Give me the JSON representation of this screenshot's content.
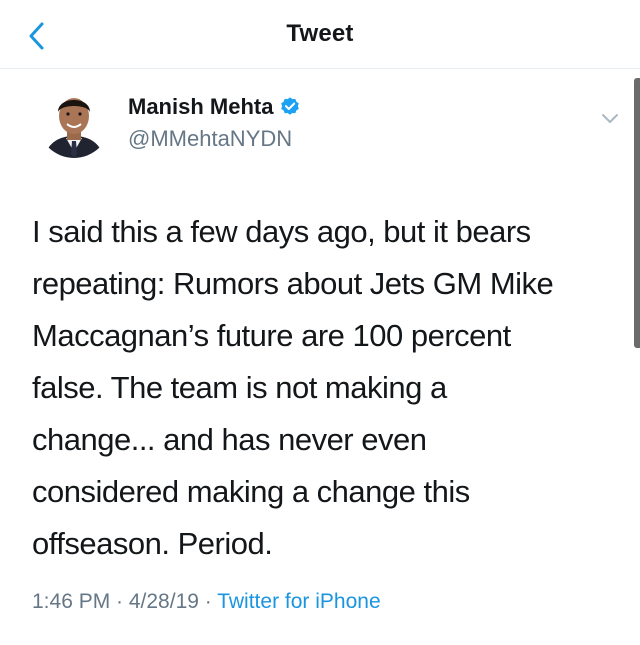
{
  "header": {
    "title": "Tweet",
    "back_icon": "chevron-left-icon"
  },
  "author": {
    "name": "Manish Mehta",
    "handle": "@MMehtaNYDN",
    "verified": true,
    "verified_icon": "verified-badge-icon"
  },
  "tweet": {
    "text": "I said this a few days ago, but it bears\nrepeating: Rumors about Jets GM Mike\nMaccagnan’s future are 100 percent\nfalse. The team is not making a\nchange... and has never even\nconsidered making a change this\noffseason. Period."
  },
  "meta": {
    "timestamp": "1:46 PM · 4/28/19 · ",
    "source": "Twitter for iPhone"
  },
  "colors": {
    "accent": "#1b95e0",
    "secondary_text": "#657786",
    "primary_text": "#14171a",
    "divider": "#e6ecf0"
  }
}
